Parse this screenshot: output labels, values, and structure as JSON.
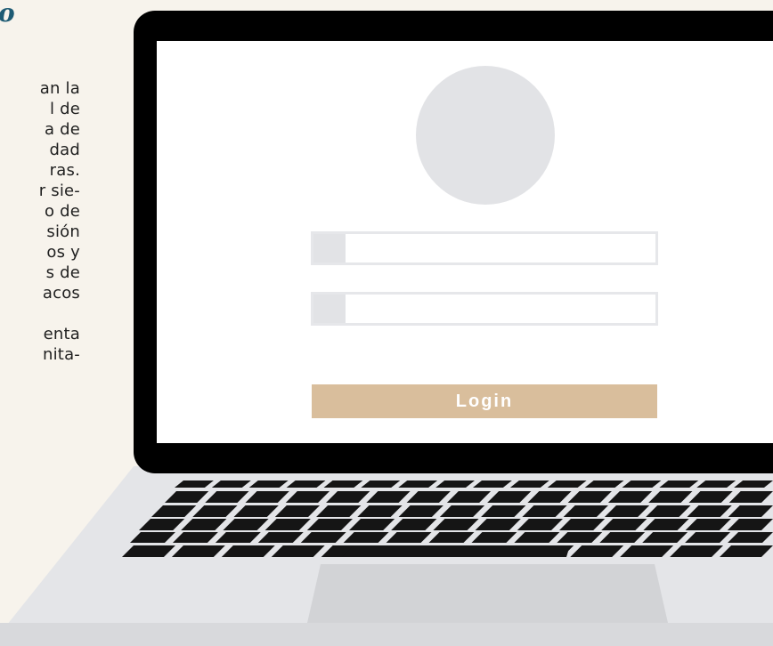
{
  "page": {
    "title_fragment": "o",
    "paragraph_lines": [
      "an la",
      "l de",
      "a de",
      "dad",
      "ras.",
      "r sie-",
      "o de",
      "sión",
      "os y",
      "s de",
      "acos",
      "",
      "enta",
      "nita-"
    ]
  },
  "laptop": {
    "login_form": {
      "username_value": "",
      "password_value": "",
      "login_label": "Login"
    }
  },
  "colors": {
    "background": "#f7f3ec",
    "title": "#1e5b74",
    "bezel": "#000000",
    "screen": "#ffffff",
    "placeholder_gray": "#e2e3e6",
    "login_button": "#d9be9c",
    "laptop_body": "#e4e5e8",
    "trackpad": "#d2d3d6"
  },
  "icons": {
    "avatar": "user-avatar-placeholder",
    "field_icon": "field-icon-placeholder"
  }
}
